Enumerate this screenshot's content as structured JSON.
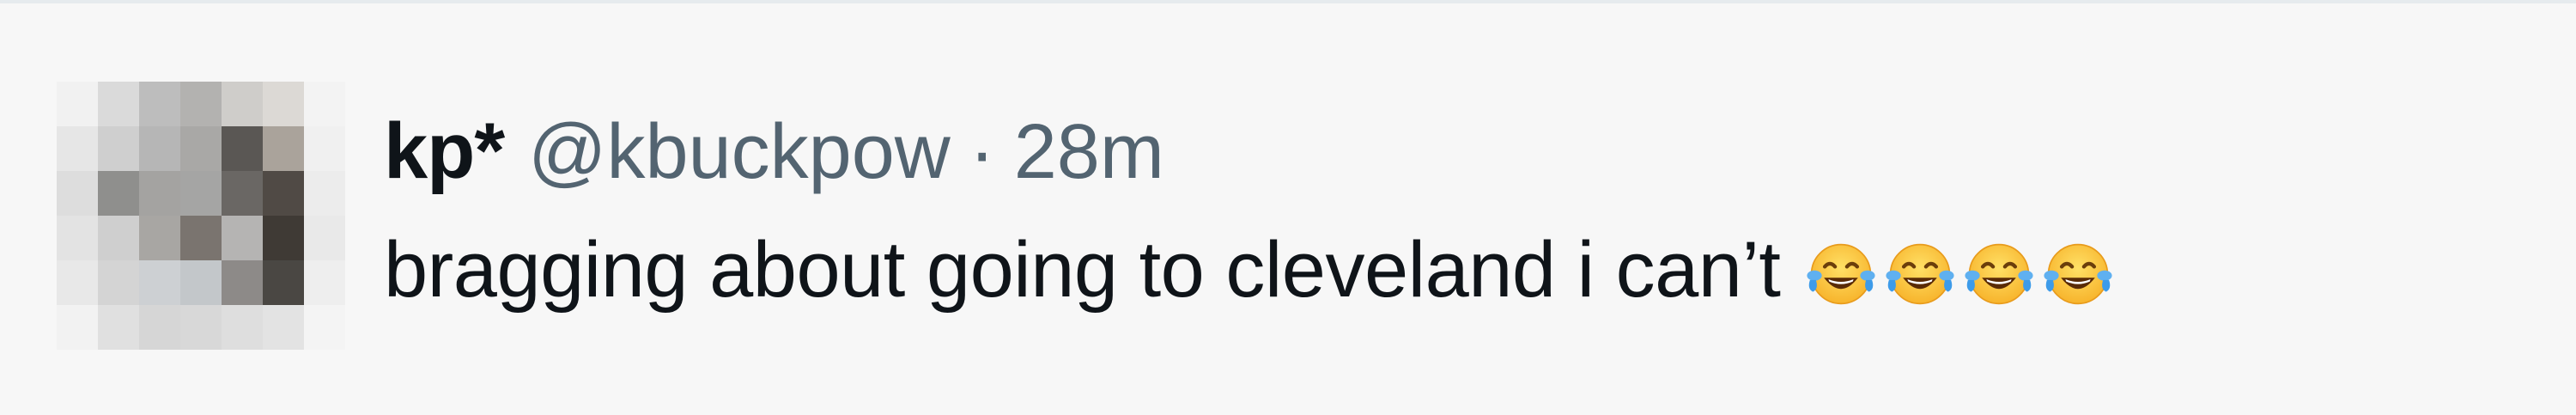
{
  "tweet": {
    "display_name": "kp*",
    "handle": "@kbuckpow",
    "separator": "·",
    "timestamp": "28m",
    "text": "bragging about going to cleveland i can’t",
    "emojis": [
      "face-with-tears-of-joy-icon",
      "face-with-tears-of-joy-icon",
      "face-with-tears-of-joy-icon",
      "face-with-tears-of-joy-icon"
    ]
  },
  "avatar": {
    "style": "pixelated-blurred",
    "pixels": [
      [
        "#f1f1f1",
        "#dadada",
        "#bdbdbd",
        "#b3b2b0",
        "#cfcdca",
        "#dcd9d5",
        "#f3f3f3"
      ],
      [
        "#e6e6e6",
        "#cfcfcf",
        "#b6b6b6",
        "#a9a8a6",
        "#5a5754",
        "#aaa39b",
        "#f0f0f0"
      ],
      [
        "#dddddd",
        "#8f8f8d",
        "#a4a3a1",
        "#a5a5a4",
        "#6a6764",
        "#504a45",
        "#ececec"
      ],
      [
        "#e3e3e3",
        "#cfcfcf",
        "#a8a6a3",
        "#7a746f",
        "#b5b4b3",
        "#3f3a35",
        "#e9e9e9"
      ],
      [
        "#e8e8e8",
        "#d4d4d4",
        "#cdd0d3",
        "#c3c7ca",
        "#8d8a88",
        "#4a4743",
        "#eeeeee"
      ],
      [
        "#f2f2f2",
        "#e0e0e0",
        "#d6d6d6",
        "#d8d8d8",
        "#dedede",
        "#e3e3e3",
        "#f4f4f4"
      ]
    ]
  },
  "colors": {
    "background": "#f7f7f7",
    "primary_text": "#0f1419",
    "secondary_text": "#536471",
    "divider": "#e6ebee"
  }
}
